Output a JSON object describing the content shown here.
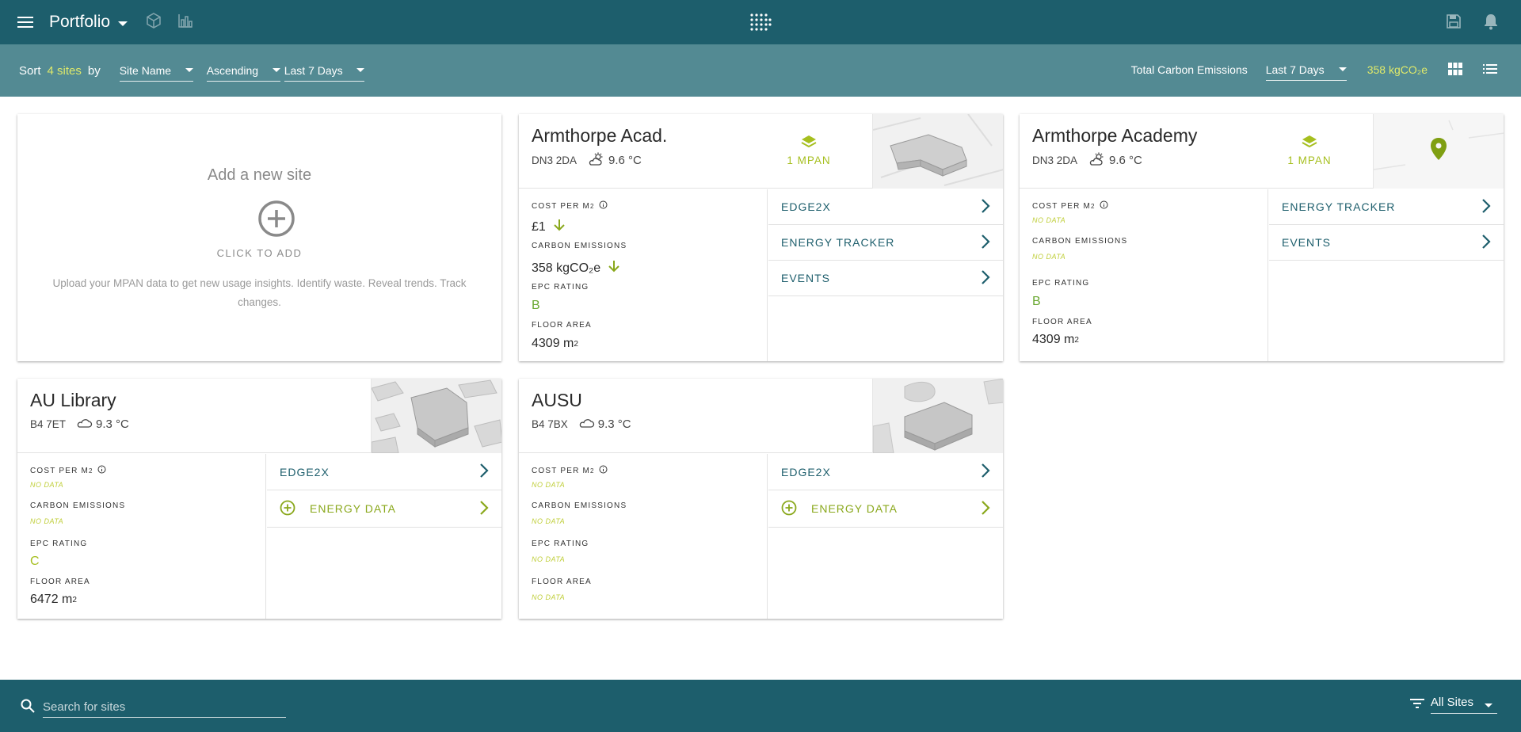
{
  "app": {
    "title": "Portfolio"
  },
  "sortbar": {
    "sort_label": "Sort",
    "count_label": "4 sites",
    "by_label": "by",
    "sort_field": "Site Name",
    "sort_order": "Ascending",
    "period": "Last 7 Days",
    "total_label": "Total Carbon Emissions",
    "total_period": "Last 7 Days",
    "total_value": "358 kgCO₂e"
  },
  "add_card": {
    "title": "Add a new site",
    "click_label": "CLICK TO ADD",
    "description": "Upload your MPAN data to get new usage insights. Identify waste. Reveal trends. Track changes."
  },
  "labels": {
    "cost": "COST PER M",
    "carbon": "CARBON EMISSIONS",
    "epc": "EPC RATING",
    "floor": "FLOOR AREA",
    "nodata": "NO DATA",
    "sup2": "2"
  },
  "sites": [
    {
      "name": "Armthorpe Acad.",
      "postcode": "DN3 2DA",
      "temp": "9.6 °C",
      "mpan": "1 MPAN",
      "cost": "£1",
      "carbon": "358 kgCO₂e",
      "epc": "B",
      "floor": "4309 m",
      "links": [
        "EDGE2X",
        "ENERGY TRACKER",
        "EVENTS"
      ]
    },
    {
      "name": "Armthorpe Academy",
      "postcode": "DN3 2DA",
      "temp": "9.6 °C",
      "mpan": "1 MPAN",
      "epc": "B",
      "floor": "4309 m",
      "links": [
        "ENERGY TRACKER",
        "EVENTS"
      ]
    },
    {
      "name": "AU Library",
      "postcode": "B4 7ET",
      "temp": "9.3 °C",
      "epc": "C",
      "floor": "6472 m",
      "links": [
        "EDGE2X",
        "ENERGY DATA"
      ]
    },
    {
      "name": "AUSU",
      "postcode": "B4 7BX",
      "temp": "9.3 °C",
      "links": [
        "EDGE2X",
        "ENERGY DATA"
      ]
    }
  ],
  "bottombar": {
    "search_placeholder": "Search for sites",
    "filter": "All Sites"
  },
  "colors": {
    "primary": "#1d5e6c",
    "secondary": "#538a93",
    "accent": "#dfe96a",
    "green": "#a6bf1f",
    "epc": "#6aa832"
  }
}
